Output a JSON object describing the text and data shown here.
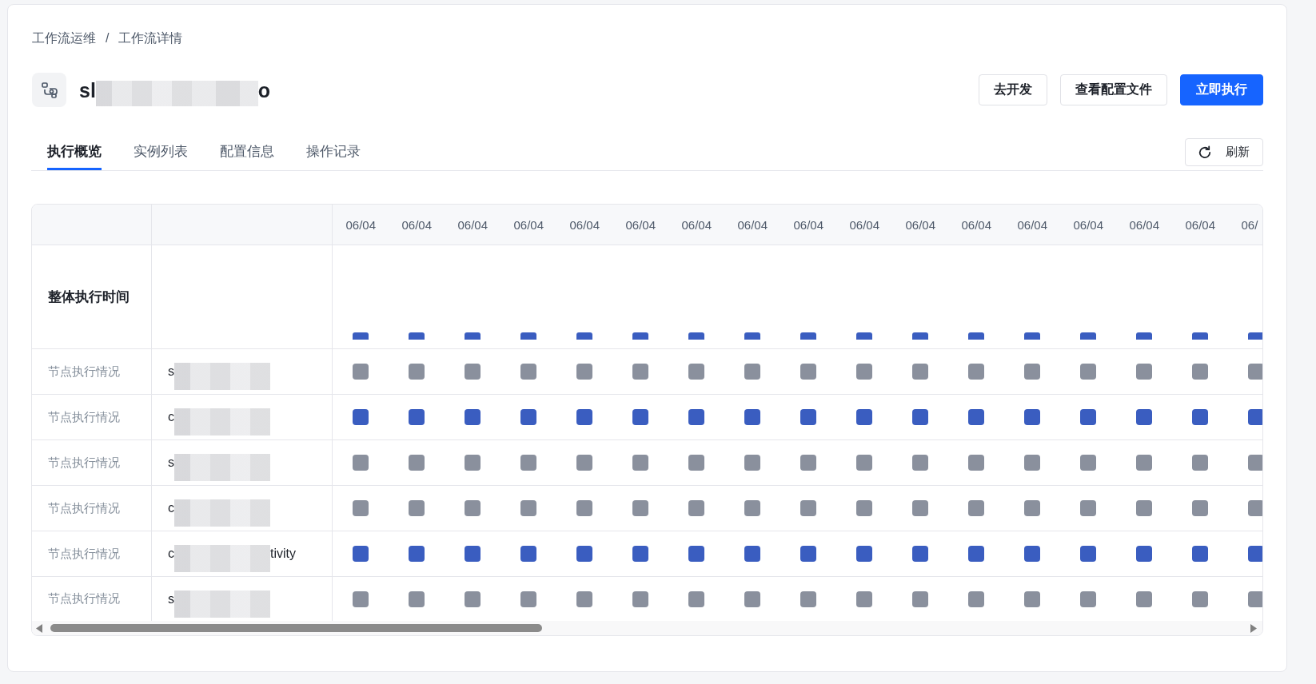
{
  "breadcrumb": {
    "items": [
      {
        "label": "工作流运维"
      },
      {
        "label": "工作流详情"
      }
    ],
    "separator": "/"
  },
  "header": {
    "title": [
      {
        "kind": "text",
        "text": "sl"
      },
      {
        "kind": "redacted"
      },
      {
        "kind": "text",
        "text": "o"
      }
    ],
    "actions": [
      {
        "label": "去开发",
        "kind": "default"
      },
      {
        "label": "查看配置文件",
        "kind": "default"
      },
      {
        "label": "立即执行",
        "kind": "primary"
      }
    ]
  },
  "tabs": [
    {
      "label": "执行概览",
      "selected": true
    },
    {
      "label": "实例列表",
      "selected": false
    },
    {
      "label": "配置信息",
      "selected": false
    },
    {
      "label": "操作记录",
      "selected": false
    }
  ],
  "refresh_button": {
    "label": "刷新"
  },
  "grid": {
    "columns": [
      "06/04",
      "06/04",
      "06/04",
      "06/04",
      "06/04",
      "06/04",
      "06/04",
      "06/04",
      "06/04",
      "06/04",
      "06/04",
      "06/04",
      "06/04",
      "06/04",
      "06/04",
      "06/04",
      "06/"
    ],
    "overall_row": {
      "label": "整体执行时间"
    },
    "node_rows": [
      {
        "label": "节点执行情况",
        "name": [
          {
            "kind": "text",
            "text": "s"
          },
          {
            "kind": "redacted"
          }
        ],
        "color": "#8a909d"
      },
      {
        "label": "节点执行情况",
        "name": [
          {
            "kind": "text",
            "text": "c"
          },
          {
            "kind": "redacted"
          }
        ],
        "color": "#3a5dc0"
      },
      {
        "label": "节点执行情况",
        "name": [
          {
            "kind": "text",
            "text": "s"
          },
          {
            "kind": "redacted"
          }
        ],
        "color": "#8a909d"
      },
      {
        "label": "节点执行情况",
        "name": [
          {
            "kind": "text",
            "text": "c"
          },
          {
            "kind": "redacted"
          }
        ],
        "color": "#8a909d"
      },
      {
        "label": "节点执行情况",
        "name": [
          {
            "kind": "text",
            "text": "c"
          },
          {
            "kind": "redacted"
          },
          {
            "kind": "text",
            "text": "tivity"
          }
        ],
        "color": "#3a5dc0"
      },
      {
        "label": "节点执行情况",
        "name": [
          {
            "kind": "text",
            "text": "s"
          },
          {
            "kind": "redacted"
          }
        ],
        "color": "#8a909d"
      }
    ]
  }
}
